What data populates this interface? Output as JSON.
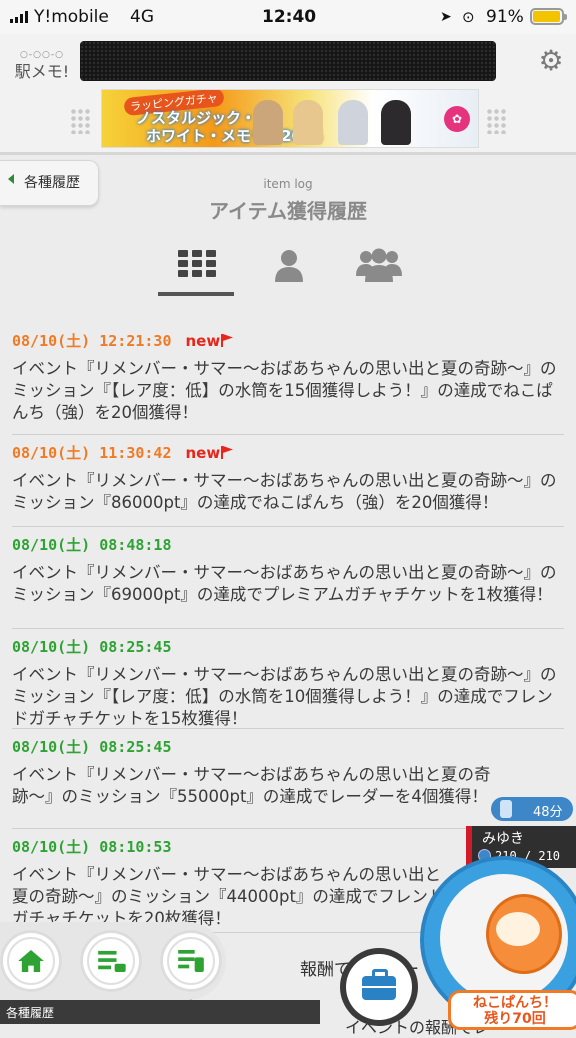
{
  "status_bar": {
    "carrier": "Y!mobile",
    "network": "4G",
    "time": "12:40",
    "battery": "91%"
  },
  "header": {
    "logo_dots": "○-○○-○",
    "logo_name": "駅メモ!",
    "banner": {
      "tag": "ラッピングガチャ",
      "line1": "ノスタルジック・",
      "line2": "ホワイト・メモリー2024"
    }
  },
  "back_tab": {
    "label": "各種履歴"
  },
  "page": {
    "title_en": "item log",
    "title_ja": "アイテム獲得履歴"
  },
  "tabs": [
    {
      "icon": "grid-icon",
      "active": true
    },
    {
      "icon": "person-icon",
      "active": false
    },
    {
      "icon": "group-icon",
      "active": false
    }
  ],
  "entries": [
    {
      "datetime": "08/10(土) 12:21:30",
      "new": "new",
      "color": "#f07a25",
      "text": "イベント『リメンバー・サマー〜おばあちゃんの思い出と夏の奇跡〜』のミッション『【レア度：低】の水筒を15個獲得しよう！』の達成でねこぱんち（強）を20個獲得！"
    },
    {
      "datetime": "08/10(土) 11:30:42",
      "new": "new",
      "color": "#f07a25",
      "text": "イベント『リメンバー・サマー〜おばあちゃんの思い出と夏の奇跡〜』のミッション『86000pt』の達成でねこぱんち（強）を20個獲得！"
    },
    {
      "datetime": "08/10(土) 08:48:18",
      "new": "",
      "color": "#2ea334",
      "text": "イベント『リメンバー・サマー〜おばあちゃんの思い出と夏の奇跡〜』のミッション『69000pt』の達成でプレミアムガチャチケットを1枚獲得！"
    },
    {
      "datetime": "08/10(土) 08:25:45",
      "new": "",
      "color": "#2ea334",
      "text": "イベント『リメンバー・サマー〜おばあちゃんの思い出と夏の奇跡〜』のミッション『【レア度：低】の水筒を10個獲得しよう！』の達成でフレンドガチャチケットを15枚獲得！"
    },
    {
      "datetime": "08/10(土) 08:25:45",
      "new": "",
      "color": "#2ea334",
      "text": "イベント『リメンバー・サマー〜おばあちゃんの思い出と夏の奇跡〜』のミッション『55000pt』の達成でレーダーを4個獲得！"
    },
    {
      "datetime": "08/10(土) 08:10:53",
      "new": "",
      "color": "#2ea334",
      "text": "イベント『リメンバー・サマー〜おばあちゃんの思い出と夏の奇跡〜』のミッション『44000pt』の達成でフレンドガチャチケットを20枚獲得！"
    }
  ],
  "partial_text": {
    "line1": "報酬でレーダー",
    "time_fragment": "59",
    "line2": "イベントの報酬でレー"
  },
  "timer": {
    "label": "48分"
  },
  "user": {
    "name": "みゆき",
    "hp": "210 / 210"
  },
  "punch": {
    "line1": "ねこぱんち！",
    "line2": "残り70回"
  },
  "nav": {
    "caption": "各種履歴"
  },
  "colors": {
    "accent_orange": "#f07a25",
    "accent_green": "#2ea334",
    "new_red": "#e8261c",
    "blue": "#2a82c4"
  }
}
